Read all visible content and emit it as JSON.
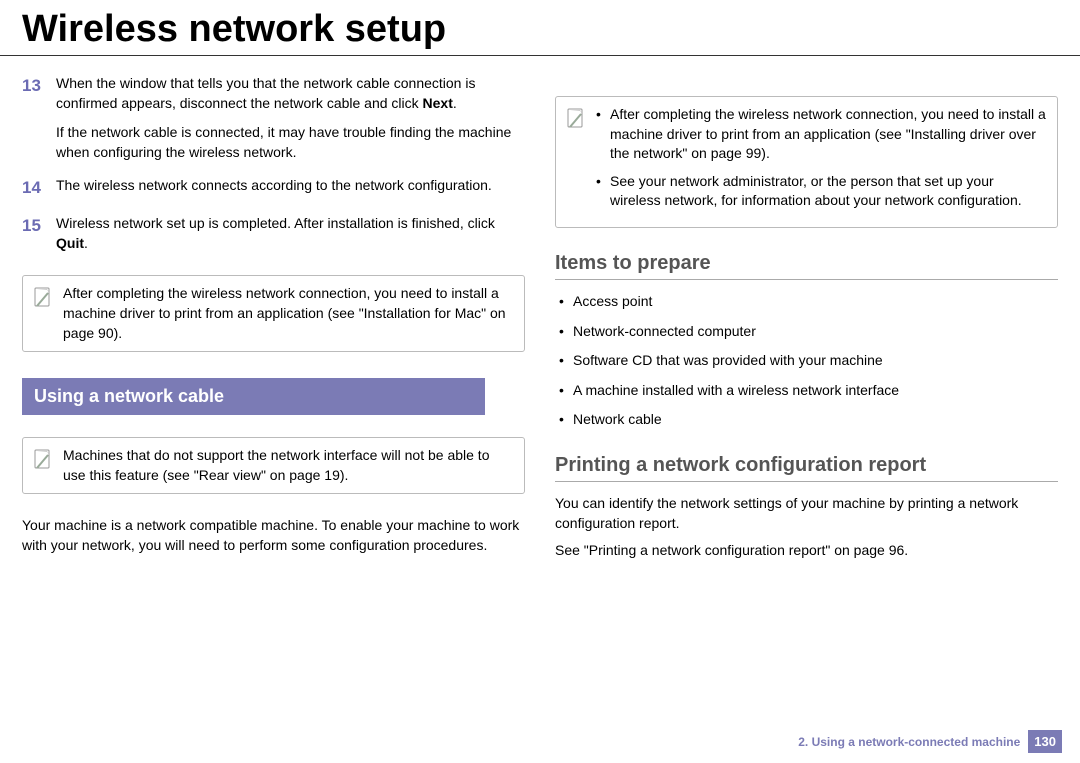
{
  "title": "Wireless network setup",
  "left": {
    "steps": [
      {
        "num": "13",
        "paras": [
          "When the window that tells you that the network cable connection is confirmed appears, disconnect the network cable and click <b>Next</b>.",
          "If the network cable is connected, it may have trouble finding the machine when configuring the wireless network."
        ]
      },
      {
        "num": "14",
        "paras": [
          "The wireless network connects according to the network configuration."
        ]
      },
      {
        "num": "15",
        "paras": [
          "Wireless network set up is completed. After installation is finished, click <b>Quit</b>."
        ]
      }
    ],
    "note1": "After completing the wireless network connection, you need to install a machine driver to print from an application (see \"Installation for Mac\" on page 90).",
    "sectionBar": "Using a network cable",
    "note2": "Machines that do not support the network interface will not be able to use this feature (see \"Rear view\" on page 19).",
    "para": "Your machine is a network compatible machine. To enable your machine to work with your network, you will need to perform some configuration procedures."
  },
  "right": {
    "noteItems": [
      "After completing the wireless network connection, you need to install a machine driver to print from an application (see \"Installing driver over the network\" on page 99).",
      "See your network administrator, or the person that set up your wireless network, for information about your network configuration."
    ],
    "sub1": "Items to prepare",
    "prepare": [
      "Access point",
      "Network-connected computer",
      "Software CD that was provided with your machine",
      "A machine installed with a wireless network interface",
      "Network cable"
    ],
    "sub2": "Printing a network configuration report",
    "para1": "You can identify the network settings of your machine by printing a network configuration report.",
    "para2": "See \"Printing a network configuration report\" on page 96."
  },
  "footer": {
    "chapter": "2.  Using a network-connected machine",
    "page": "130"
  }
}
